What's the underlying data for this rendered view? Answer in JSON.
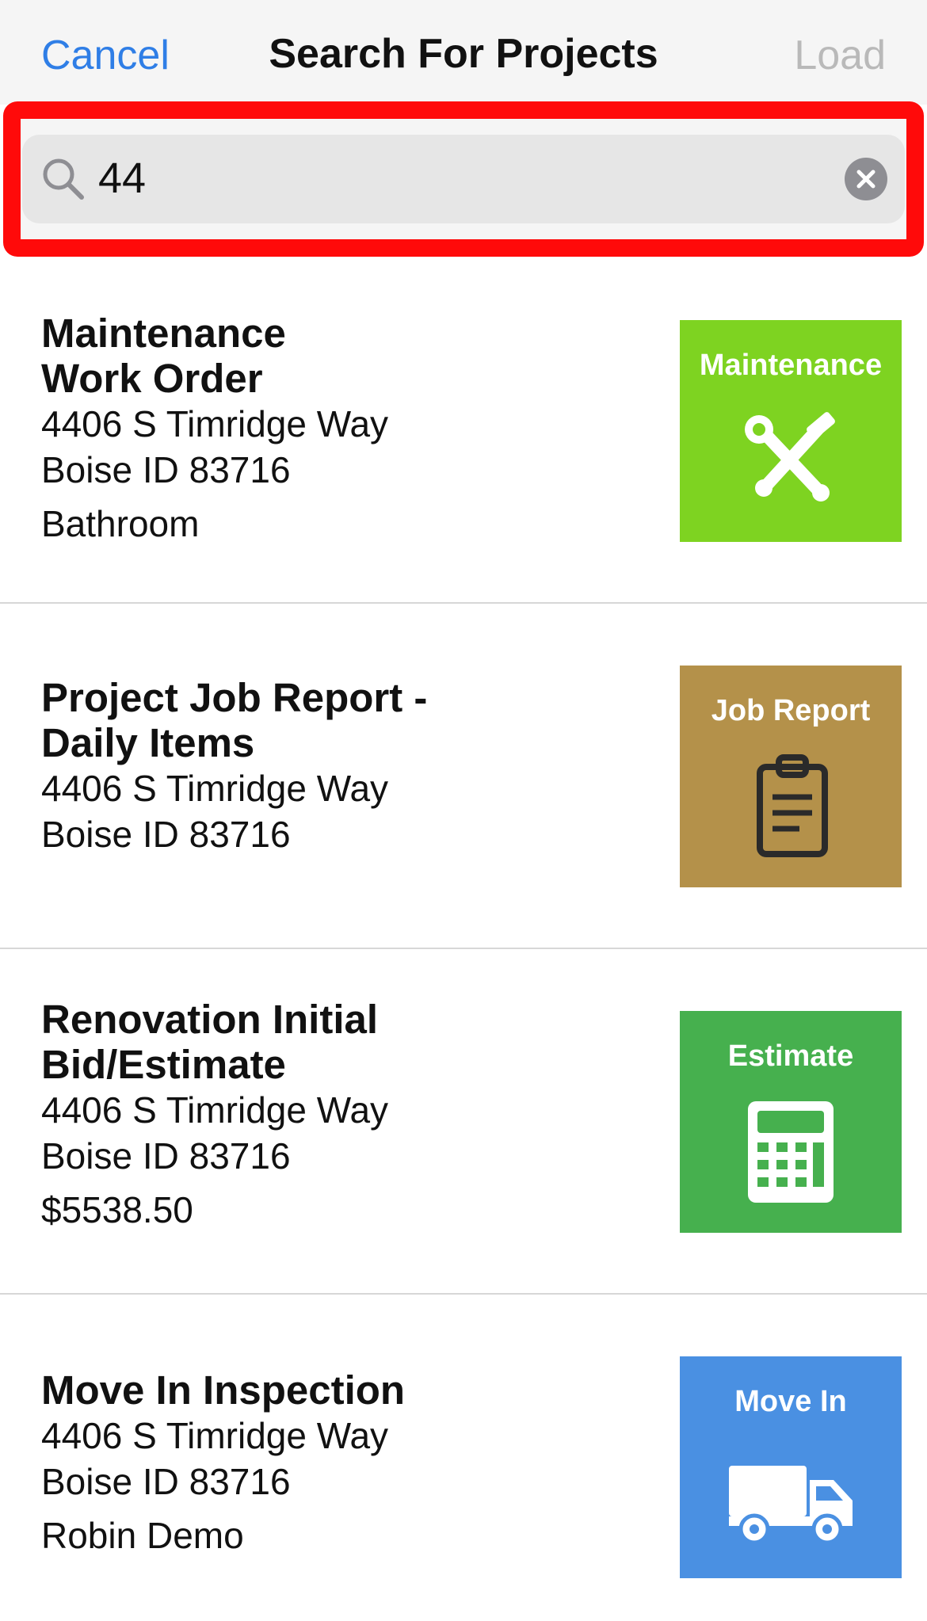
{
  "header": {
    "cancel_label": "Cancel",
    "title": "Search For Projects",
    "load_label": "Load"
  },
  "search": {
    "value": "44",
    "icon": "search-icon",
    "clear_icon": "clear-circle-icon"
  },
  "items": [
    {
      "title_line1": "Maintenance",
      "title_line2": "Work Order",
      "address1": "4406 S Timridge Way",
      "address2": "Boise ID 83716",
      "extra": "Bathroom",
      "tile_label": "Maintenance",
      "tile_color": "#7ed321",
      "tile_icon": "tools-icon"
    },
    {
      "title_line1": "Project Job Report -",
      "title_line2": "Daily Items",
      "address1": "4406 S Timridge Way",
      "address2": "Boise ID 83716",
      "extra": "",
      "tile_label": "Job Report",
      "tile_color": "#b4914a",
      "tile_icon": "clipboard-icon"
    },
    {
      "title_line1": "Renovation Initial",
      "title_line2": "Bid/Estimate",
      "address1": "4406 S Timridge Way",
      "address2": "Boise ID 83716",
      "extra": "$5538.50",
      "tile_label": "Estimate",
      "tile_color": "#46b04e",
      "tile_icon": "calculator-icon"
    },
    {
      "title_line1": "Move In Inspection",
      "title_line2": "",
      "address1": "4406 S Timridge Way",
      "address2": "Boise ID 83716",
      "extra": "Robin Demo",
      "tile_label": "Move In",
      "tile_color": "#4a90e2",
      "tile_icon": "truck-icon"
    }
  ],
  "colors": {
    "accent": "#2f7ee6",
    "disabled": "#b9b9b9",
    "highlight": "#ff0a0a"
  }
}
